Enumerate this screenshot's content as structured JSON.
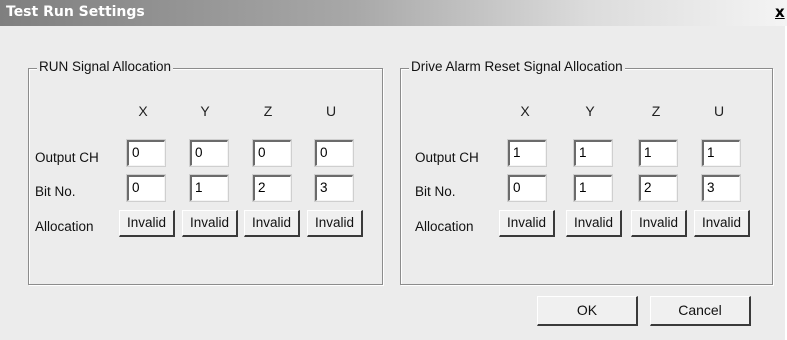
{
  "window": {
    "title": "Test Run Settings",
    "close_label": "x"
  },
  "columns": [
    "X",
    "Y",
    "Z",
    "U"
  ],
  "row_labels": {
    "output_ch": "Output CH",
    "bit_no": "Bit No.",
    "allocation": "Allocation"
  },
  "run_group": {
    "title": "RUN Signal Allocation",
    "output_ch": [
      "0",
      "0",
      "0",
      "0"
    ],
    "bit_no": [
      "0",
      "1",
      "2",
      "3"
    ],
    "allocation": [
      "Invalid",
      "Invalid",
      "Invalid",
      "Invalid"
    ]
  },
  "reset_group": {
    "title": "Drive Alarm Reset Signal Allocation",
    "output_ch": [
      "1",
      "1",
      "1",
      "1"
    ],
    "bit_no": [
      "0",
      "1",
      "2",
      "3"
    ],
    "allocation": [
      "Invalid",
      "Invalid",
      "Invalid",
      "Invalid"
    ]
  },
  "buttons": {
    "ok": "OK",
    "cancel": "Cancel"
  }
}
